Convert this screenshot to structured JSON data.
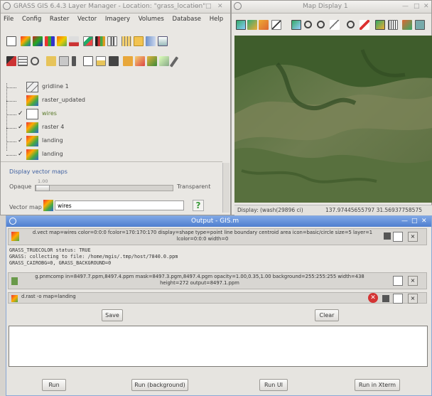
{
  "left_window": {
    "title": "GRASS GIS 6.4.3 Layer Manager - Location: \"grass_location\"",
    "menu": [
      "File",
      "Config",
      "Raster",
      "Vector",
      "Imagery",
      "Volumes",
      "Database",
      "Help"
    ],
    "layers": [
      {
        "name": "gridline 1",
        "checked": false,
        "icon": "vector-layer-icon"
      },
      {
        "name": "raster_updated",
        "checked": false,
        "icon": "raster-layer-icon"
      },
      {
        "name": "wires",
        "checked": true,
        "icon": "vector-layer-icon"
      },
      {
        "name": "raster 4",
        "checked": true,
        "icon": "raster-layer-icon"
      },
      {
        "name": "landing",
        "checked": true,
        "icon": "raster-layer-icon"
      },
      {
        "name": "landing",
        "checked": true,
        "icon": "raster-layer-icon"
      }
    ],
    "section_label": "Display vector maps",
    "opacity_label": "Opaque",
    "opacity_value": "1.00",
    "transparent_label": "Transparent",
    "vector_map_label": "Vector map",
    "vector_map_value": "wires"
  },
  "map_window": {
    "title": "Map Display 1",
    "status_left": "Display: (wash(29896 ci)",
    "status_right": "137.97445655797 31.56937758575"
  },
  "output_window": {
    "title": "Output - GIS.m",
    "command1": "d.vect map=wires color=0:0:0 fcolor=170:170:170 display=shape type=point line boundary centroid area icon=basic/circle size=5 layer=1 lcolor=0:0:0 width=0",
    "log_lines": [
      "GRASS_TRUECOLOR status: TRUE",
      "GRASS: collecting to file: /home/mgis/.tmp/host/7840.0.ppm",
      "   GRASS_CAIROBG=0, GRASS_BACKGROUND=0"
    ],
    "command2": "g.pnmcomp in=8497.7.ppm,8497.4.ppm mask=8497.3.pgm,8497.4.pgm opacity=1.00,0.35,1.00 background=255:255:255 width=438 height=272 output=8497.1.ppm",
    "command3": "d.rast -o map=landing",
    "save_label": "Save",
    "clear_label": "Clear",
    "run_label": "Run",
    "run_bg_label": "Run (background)",
    "run_ui_label": "Run UI",
    "run_xterm_label": "Run in Xterm"
  },
  "colors": {
    "title_active": "#5a87d4",
    "map_green": "#3f5a2e",
    "error_red": "#d43434"
  }
}
